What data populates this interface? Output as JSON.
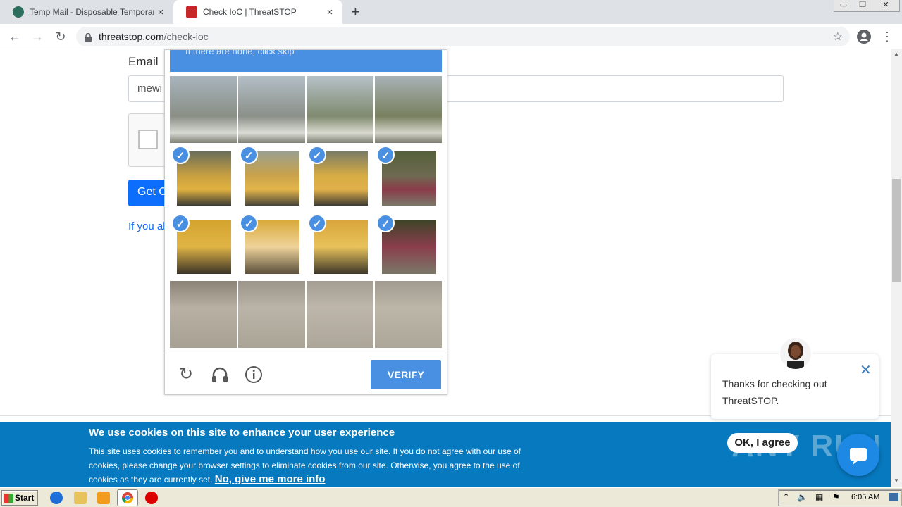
{
  "browser": {
    "tabs": [
      {
        "title": "Temp Mail - Disposable Temporary E",
        "close": "×",
        "favicon": "tempmail-icon"
      },
      {
        "title": "Check IoC | ThreatSTOP",
        "close": "×",
        "favicon": "threatstop-icon"
      }
    ],
    "new_tab": "+",
    "window_controls": [
      "▭",
      "❐",
      "✕"
    ],
    "url_domain": "threatstop.com",
    "url_path": "/check-ioc"
  },
  "form": {
    "email_label": "Email",
    "email_value": "mewi",
    "button_label": "Get C",
    "link_text": "If you al"
  },
  "captcha": {
    "header_text": "If there are none, click skip",
    "selected_cells": [
      4,
      5,
      6,
      7,
      8,
      9,
      10,
      11
    ],
    "verify_label": "VERIFY",
    "icons": [
      "refresh-icon",
      "headphones-icon",
      "info-icon"
    ]
  },
  "chat": {
    "message": "Thanks for checking out ThreatSTOP.",
    "close": "✕"
  },
  "cookie": {
    "title": "We use cookies on this site to enhance your user experience",
    "body": "This site uses cookies to remember you and to understand how you use our site. If you do not agree with our use of cookies, please change your browser settings to eliminate cookies from our site. Otherwise, you agree to the use of cookies as they are currently set.",
    "more_link": "No, give me more info",
    "agree_label": "OK, I agree"
  },
  "watermark": "ANY RUN",
  "taskbar": {
    "start_label": "Start",
    "clock": "6:05 AM"
  }
}
